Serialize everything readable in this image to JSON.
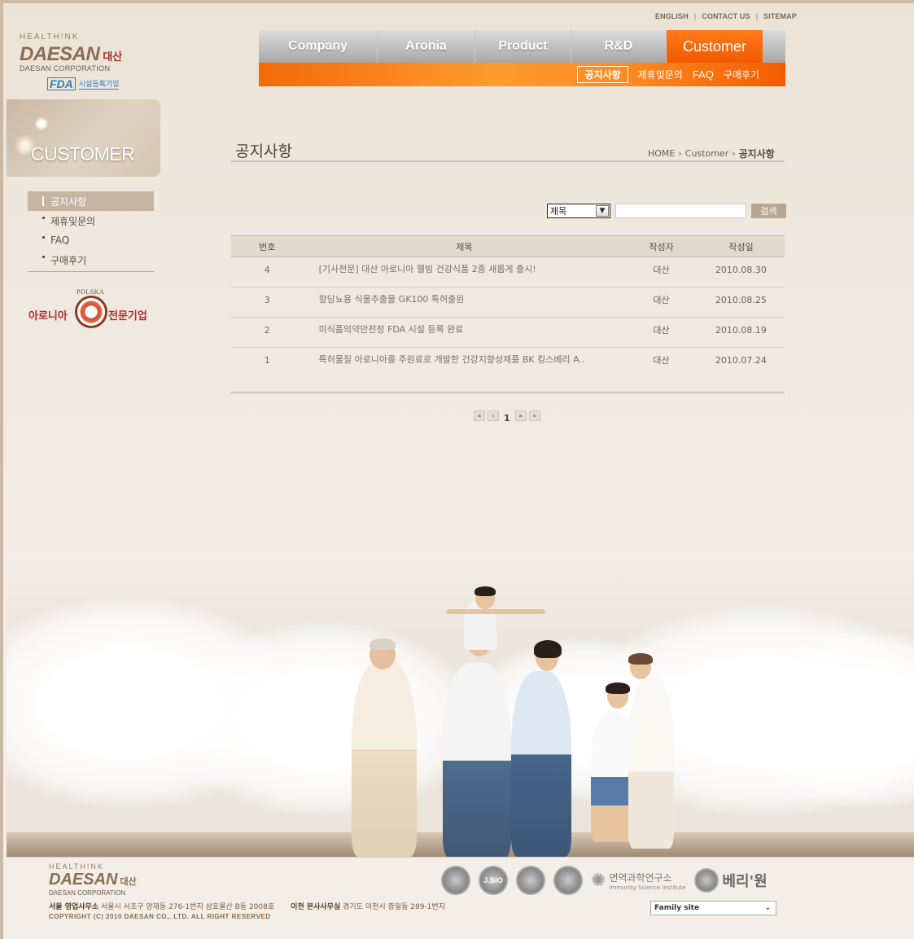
{
  "util_links": [
    "ENGLISH",
    "CONTACT US",
    "SITEMAP"
  ],
  "logo": {
    "tag": "HEALTH!NK",
    "brand_en": "DAESAN",
    "brand_ko": "대산",
    "corp": "DAESAN CORPORATION"
  },
  "fda": {
    "mark": "FDA",
    "text": "시설등록기업"
  },
  "gnb": [
    {
      "label": "Company"
    },
    {
      "label": "Aronia"
    },
    {
      "label": "Product"
    },
    {
      "label": "R&D"
    },
    {
      "label": "Customer"
    }
  ],
  "sub_nav": [
    "공지사항",
    "제휴및문의",
    "FAQ",
    "구매후기"
  ],
  "side_visual_title": "CUSTOMER",
  "lnb": [
    "공지사항",
    "제휴및문의",
    "FAQ",
    "구매후기"
  ],
  "badge": {
    "top": "POLSKA",
    "left": "아로니아",
    "right": "전문기업"
  },
  "page_title": "공지사항",
  "location": {
    "home": "HOME",
    "section": "Customer",
    "current": "공지사항"
  },
  "search": {
    "field": "제목",
    "button": "검색"
  },
  "board": {
    "headers": [
      "번호",
      "제목",
      "작성자",
      "작성일"
    ],
    "rows": [
      {
        "num": "4",
        "subject": "[기사전문] 대산 아로니아 웰빙 건강식품 2종 새롭게 출시!",
        "author": "대산",
        "date": "2010.08.30"
      },
      {
        "num": "3",
        "subject": "항당뇨용 식물추출물 GK100 특허출원",
        "author": "대산",
        "date": "2010.08.25"
      },
      {
        "num": "2",
        "subject": "미식품의약안전청 FDA 시설 등록 완료",
        "author": "대산",
        "date": "2010.08.19"
      },
      {
        "num": "1",
        "subject": "특허물질 아로니아를 주원료로 개발한 건강지향성제품 BK 킹스베리 A..",
        "author": "대산",
        "date": "2010.07.24"
      }
    ]
  },
  "paging": {
    "current": "1"
  },
  "footer": {
    "tag": "HEALTH!NK",
    "brand_en": "DAESAN",
    "brand_ko": "대산",
    "corp": "DAESAN CORPORATION",
    "seoul_label": "서울 영업사무소",
    "seoul_addr": "서울시 서초구 양재동 276-1번지 삼호물산 B동 2008호",
    "icheon_label": "이천 본사사무실",
    "icheon_addr": "경기도 이천시 증일동 289-1번지",
    "copyright": "COPYRIGHT (C) 2010 DAESAN CO,. LTD. ALL RIGHT RESERVED",
    "cert_j": "J.BIO",
    "institute": "면역과학연구소",
    "institute_en": "Immunity Science Institute",
    "berry": "베리'원",
    "family_site": "Family site"
  }
}
